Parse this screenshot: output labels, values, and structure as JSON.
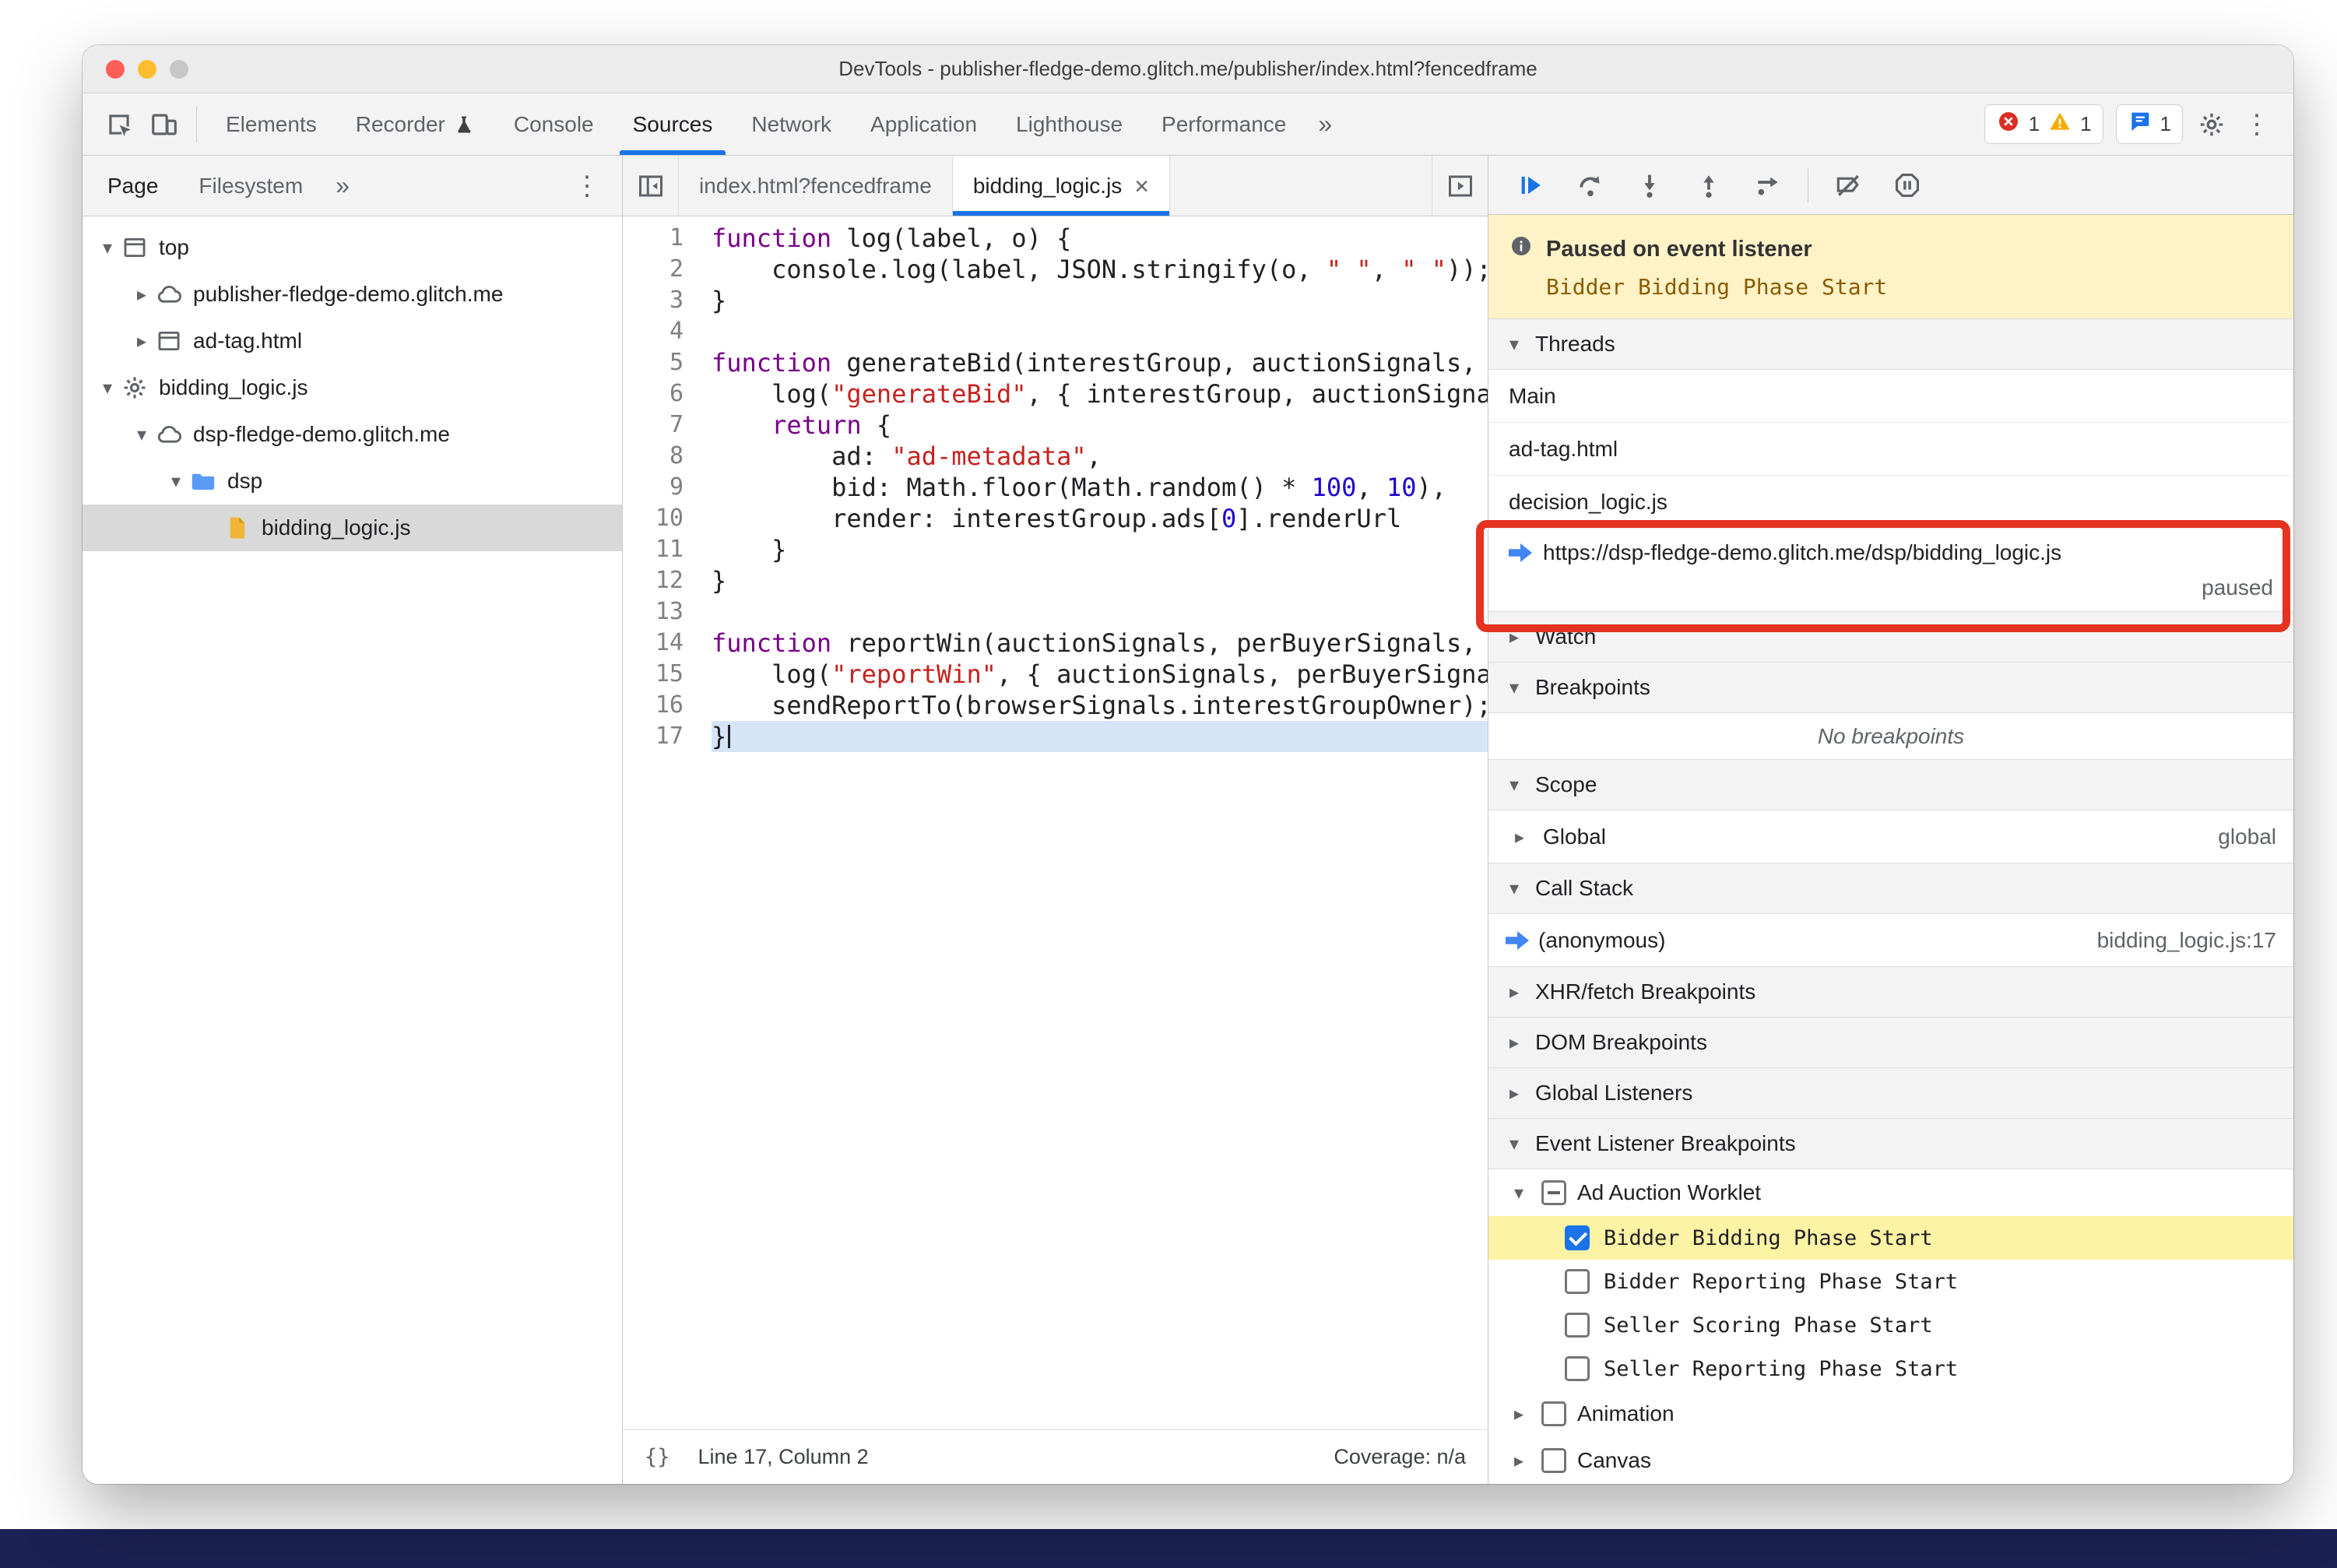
{
  "window": {
    "title": "DevTools - publisher-fledge-demo.glitch.me/publisher/index.html?fencedframe"
  },
  "colors": {
    "accent_blue": "#1a73e8",
    "annotation_red": "#e53322",
    "paused_banner_bg": "#fff2c7",
    "desktop_strip_navy": "#1b2153"
  },
  "icons": {
    "kebab": "⋮",
    "chevron_double": "»",
    "disclosure_open": "▾",
    "disclosure_closed": "▸",
    "close": "×"
  },
  "toolbar": {
    "tabs": [
      {
        "label": "Elements",
        "active": false
      },
      {
        "label": "Recorder",
        "active": false,
        "icon": "flask"
      },
      {
        "label": "Console",
        "active": false
      },
      {
        "label": "Sources",
        "active": true
      },
      {
        "label": "Network",
        "active": false
      },
      {
        "label": "Application",
        "active": false
      },
      {
        "label": "Lighthouse",
        "active": false
      },
      {
        "label": "Performance",
        "active": false
      }
    ],
    "more": "»",
    "error_count": "1",
    "warning_count": "1",
    "issues_count": "1"
  },
  "navigator": {
    "tabs": [
      {
        "label": "Page",
        "active": true
      },
      {
        "label": "Filesystem",
        "active": false
      }
    ],
    "more": "»",
    "tree": [
      {
        "label": "top",
        "icon": "frame",
        "depth": 0,
        "expand": "open"
      },
      {
        "label": "publisher-fledge-demo.glitch.me",
        "icon": "cloud",
        "depth": 1,
        "expand": "closed"
      },
      {
        "label": "ad-tag.html",
        "icon": "frame",
        "depth": 1,
        "expand": "closed"
      },
      {
        "label": "bidding_logic.js",
        "icon": "gear",
        "depth": 0,
        "expand": "open"
      },
      {
        "label": "dsp-fledge-demo.glitch.me",
        "icon": "cloud",
        "depth": 1,
        "expand": "open"
      },
      {
        "label": "dsp",
        "icon": "folder",
        "depth": 2,
        "expand": "open"
      },
      {
        "label": "bidding_logic.js",
        "icon": "file",
        "depth": 3,
        "expand": "none",
        "selected": true
      }
    ]
  },
  "editor": {
    "tabs": [
      {
        "label": "index.html?fencedframe",
        "active": false,
        "closable": false
      },
      {
        "label": "bidding_logic.js",
        "active": true,
        "closable": true
      }
    ],
    "status": {
      "braces": "{}",
      "position": "Line 17, Column 2",
      "coverage": "Coverage: n/a"
    },
    "lines": [
      {
        "n": 1,
        "segs": [
          [
            "k",
            "function"
          ],
          [
            "p",
            " log(label, o) {"
          ]
        ]
      },
      {
        "n": 2,
        "segs": [
          [
            "p",
            "    console.log(label, JSON.stringify(o, "
          ],
          [
            "s",
            "\" \""
          ],
          [
            "p",
            ", "
          ],
          [
            "s",
            "\" \""
          ],
          [
            "p",
            "));"
          ]
        ]
      },
      {
        "n": 3,
        "segs": [
          [
            "p",
            "}"
          ]
        ]
      },
      {
        "n": 4,
        "segs": []
      },
      {
        "n": 5,
        "segs": [
          [
            "k",
            "function"
          ],
          [
            "p",
            " generateBid(interestGroup, auctionSignals, perBuyerSignals, trustedBiddingSignals, browserSignals) {"
          ]
        ]
      },
      {
        "n": 6,
        "segs": [
          [
            "p",
            "    log("
          ],
          [
            "s",
            "\"generateBid\""
          ],
          [
            "p",
            ", { interestGroup, auctionSignals, perBuyerSignals, trustedBiddingSignals });"
          ]
        ]
      },
      {
        "n": 7,
        "segs": [
          [
            "p",
            "    "
          ],
          [
            "k",
            "return"
          ],
          [
            "p",
            " {"
          ]
        ]
      },
      {
        "n": 8,
        "segs": [
          [
            "p",
            "        ad: "
          ],
          [
            "s",
            "\"ad-metadata\""
          ],
          [
            "p",
            ","
          ]
        ]
      },
      {
        "n": 9,
        "segs": [
          [
            "p",
            "        bid: Math.floor(Math.random() * "
          ],
          [
            "n",
            "100"
          ],
          [
            "p",
            ", "
          ],
          [
            "n",
            "10"
          ],
          [
            "p",
            "),"
          ]
        ]
      },
      {
        "n": 10,
        "segs": [
          [
            "p",
            "        render: interestGroup.ads["
          ],
          [
            "n",
            "0"
          ],
          [
            "p",
            "].renderUrl"
          ]
        ]
      },
      {
        "n": 11,
        "segs": [
          [
            "p",
            "    }"
          ]
        ]
      },
      {
        "n": 12,
        "segs": [
          [
            "p",
            "}"
          ]
        ]
      },
      {
        "n": 13,
        "segs": []
      },
      {
        "n": 14,
        "segs": [
          [
            "k",
            "function"
          ],
          [
            "p",
            " reportWin(auctionSignals, perBuyerSignals, sellerSignals, browserSignals) {"
          ]
        ]
      },
      {
        "n": 15,
        "segs": [
          [
            "p",
            "    log("
          ],
          [
            "s",
            "\"reportWin\""
          ],
          [
            "p",
            ", { auctionSignals, perBuyerSignals, sellerSignals, browserSignals });"
          ]
        ]
      },
      {
        "n": 16,
        "segs": [
          [
            "p",
            "    sendReportTo(browserSignals.interestGroupOwner);"
          ]
        ]
      },
      {
        "n": 17,
        "exec": true,
        "segs": [
          [
            "p",
            "}"
          ]
        ]
      }
    ]
  },
  "debugger": {
    "paused": {
      "title": "Paused on event listener",
      "detail": "Bidder Bidding Phase Start"
    },
    "threads": {
      "title": "Threads",
      "items": [
        {
          "label": "Main"
        },
        {
          "label": "ad-tag.html"
        },
        {
          "label": "decision_logic.js"
        },
        {
          "label": "https://dsp-fledge-demo.glitch.me/dsp/bidding_logic.js",
          "status": "paused",
          "current": true
        }
      ]
    },
    "watch": {
      "title": "Watch"
    },
    "breakpoints": {
      "title": "Breakpoints",
      "empty": "No breakpoints"
    },
    "scope": {
      "title": "Scope",
      "rows": [
        {
          "label": "Global",
          "value": "global"
        }
      ]
    },
    "call_stack": {
      "title": "Call Stack",
      "frames": [
        {
          "label": "(anonymous)",
          "location": "bidding_logic.js:17",
          "current": true
        }
      ]
    },
    "xhr": {
      "title": "XHR/fetch Breakpoints"
    },
    "dom": {
      "title": "DOM Breakpoints"
    },
    "global_listeners": {
      "title": "Global Listeners"
    },
    "event_listener_breakpoints": {
      "title": "Event Listener Breakpoints",
      "groups": [
        {
          "label": "Ad Auction Worklet",
          "state": "indeterminate",
          "expanded": true,
          "items": [
            {
              "label": "Bidder Bidding Phase Start",
              "checked": true,
              "highlighted": true
            },
            {
              "label": "Bidder Reporting Phase Start",
              "checked": false
            },
            {
              "label": "Seller Scoring Phase Start",
              "checked": false
            },
            {
              "label": "Seller Reporting Phase Start",
              "checked": false
            }
          ]
        },
        {
          "label": "Animation",
          "state": "unchecked",
          "expanded": false,
          "items": []
        },
        {
          "label": "Canvas",
          "state": "unchecked",
          "expanded": false,
          "items": []
        }
      ]
    }
  }
}
